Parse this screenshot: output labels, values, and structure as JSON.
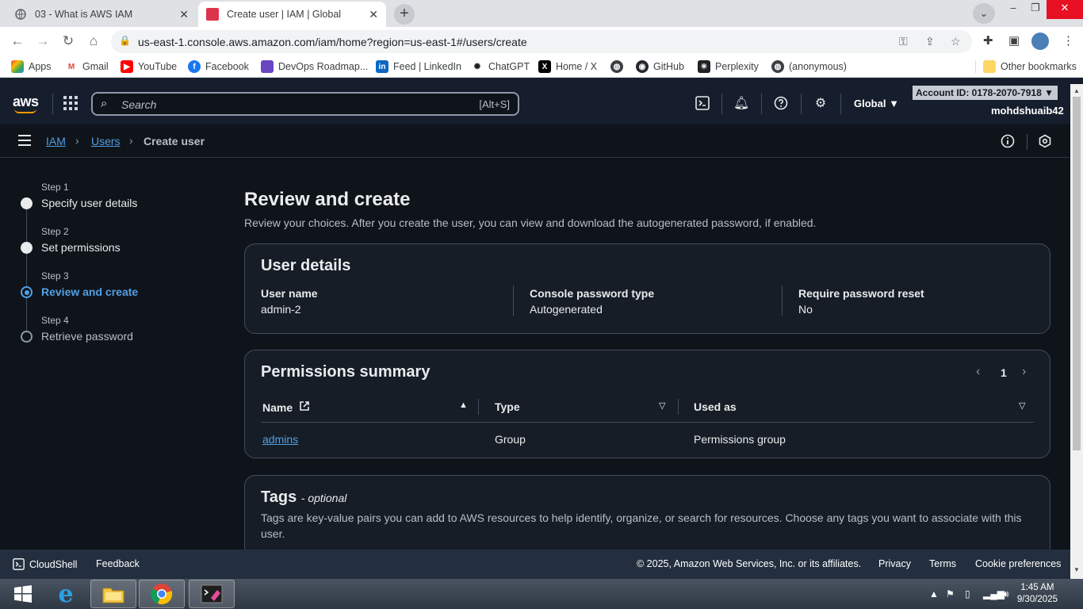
{
  "browser": {
    "tabs": [
      {
        "title": "03 - What is AWS IAM",
        "active": false
      },
      {
        "title": "Create user | IAM | Global",
        "active": true
      }
    ],
    "url": "us-east-1.console.aws.amazon.com/iam/home?region=us-east-1#/users/create",
    "bookmarks": [
      "Apps",
      "Gmail",
      "YouTube",
      "Facebook",
      "DevOps Roadmap...",
      "Feed | LinkedIn",
      "ChatGPT",
      "Home / X",
      "",
      "GitHub",
      "Perplexity",
      "(anonymous)"
    ],
    "other_bookmarks": "Other bookmarks"
  },
  "aws_header": {
    "logo": "aws",
    "search_placeholder": "Search",
    "search_shortcut": "[Alt+S]",
    "region": "Global",
    "account_id": "Account ID: 0178-2070-7918",
    "username": "mohdshuaib42"
  },
  "breadcrumb": [
    "IAM",
    "Users",
    "Create user"
  ],
  "steps": [
    {
      "label": "Step 1",
      "title": "Specify user details",
      "state": "done"
    },
    {
      "label": "Step 2",
      "title": "Set permissions",
      "state": "done"
    },
    {
      "label": "Step 3",
      "title": "Review and create",
      "state": "current"
    },
    {
      "label": "Step 4",
      "title": "Retrieve password",
      "state": "pending"
    }
  ],
  "page": {
    "title": "Review and create",
    "description": "Review your choices. After you create the user, you can view and download the autogenerated password, if enabled."
  },
  "user_details": {
    "heading": "User details",
    "fields": [
      {
        "key": "User name",
        "value": "admin-2"
      },
      {
        "key": "Console password type",
        "value": "Autogenerated"
      },
      {
        "key": "Require password reset",
        "value": "No"
      }
    ]
  },
  "permissions_summary": {
    "heading": "Permissions summary",
    "page_number": "1",
    "columns": [
      "Name",
      "Type",
      "Used as"
    ],
    "rows": [
      {
        "name": "admins",
        "type": "Group",
        "used_as": "Permissions group"
      }
    ]
  },
  "tags": {
    "heading": "Tags",
    "optional": "- optional",
    "description": "Tags are key-value pairs you can add to AWS resources to help identify, organize, or search for resources. Choose any tags you want to associate with this user."
  },
  "footer": {
    "cloudshell": "CloudShell",
    "feedback": "Feedback",
    "copyright": "© 2025, Amazon Web Services, Inc. or its affiliates.",
    "links": [
      "Privacy",
      "Terms",
      "Cookie preferences"
    ]
  },
  "taskbar": {
    "time": "1:45 AM",
    "date": "9/30/2025"
  },
  "colors": {
    "link": "#539fe5",
    "accent_orange": "#ff9900",
    "bg": "#0f141a"
  }
}
